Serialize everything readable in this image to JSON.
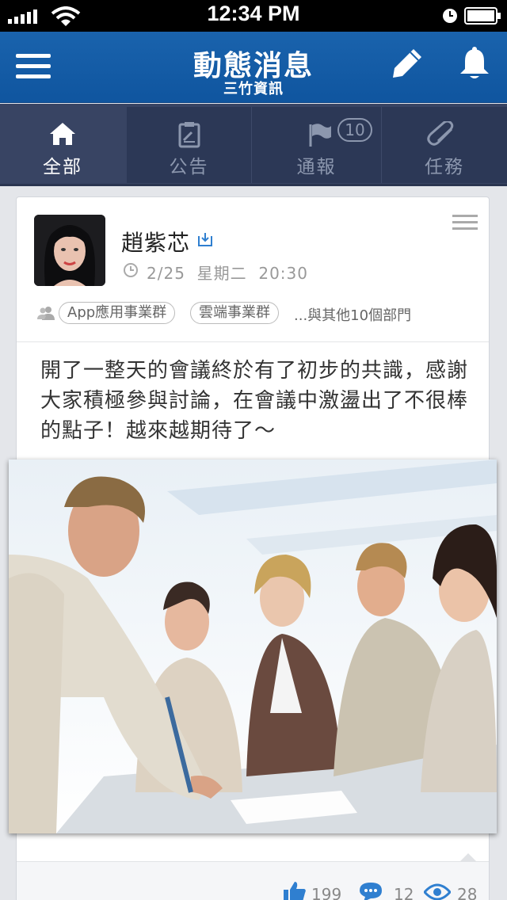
{
  "status": {
    "time": "12:34 PM"
  },
  "nav": {
    "title": "動態消息",
    "subtitle": "三竹資訊"
  },
  "tabs": [
    {
      "label": "全部",
      "icon": "home-icon"
    },
    {
      "label": "公告",
      "icon": "clipboard-icon"
    },
    {
      "label": "通報",
      "icon": "flag-icon",
      "badge": "10"
    },
    {
      "label": "任務",
      "icon": "paperclip-icon"
    }
  ],
  "post": {
    "author": "趙紫芯",
    "date": "2/25  星期二  20:30",
    "tags": [
      "App應用事業群",
      "雲端事業群"
    ],
    "others": "...與其他10個部門",
    "content": "開了一整天的會議終於有了初步的共識，感謝大家積極參與討論，在會議中激盪出了不很棒的點子！越來越期待了～",
    "likes": "199",
    "comments": "12",
    "views": "28"
  },
  "colors": {
    "nav": "#1a63ad",
    "tabbar": "#384463",
    "accent": "#2f7fd0"
  }
}
